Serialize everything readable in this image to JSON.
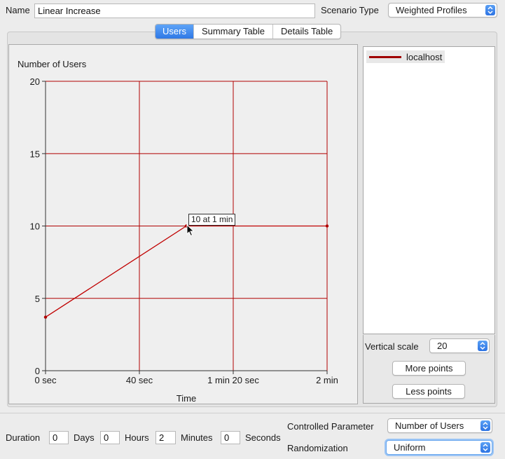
{
  "header": {
    "name_label": "Name",
    "name_value": "Linear Increase",
    "scenario_type_label": "Scenario Type",
    "scenario_type_value": "Weighted Profiles"
  },
  "tabs": [
    {
      "label": "Users",
      "active": true
    },
    {
      "label": "Summary Table",
      "active": false
    },
    {
      "label": "Details Table",
      "active": false
    }
  ],
  "chart_data": {
    "type": "line",
    "title": "",
    "xlabel": "Time",
    "ylabel": "Number of Users",
    "x_ticks": [
      "0 sec",
      "40 sec",
      "1 min 20 sec",
      "2 min"
    ],
    "x_tick_seconds": [
      0,
      40,
      80,
      120
    ],
    "y_ticks": [
      0,
      5,
      10,
      15,
      20
    ],
    "xlim": [
      0,
      120
    ],
    "ylim": [
      0,
      20
    ],
    "grid": true,
    "series": [
      {
        "name": "localhost",
        "color": "#c00000",
        "x": [
          0,
          60,
          120
        ],
        "y": [
          3.7,
          10,
          10
        ]
      }
    ],
    "tooltip": "10 at 1 min"
  },
  "legend": {
    "items": [
      {
        "label": "localhost",
        "color": "#a00000"
      }
    ]
  },
  "side_controls": {
    "vertical_scale_label": "Vertical scale",
    "vertical_scale_value": "20",
    "more_points_label": "More points",
    "less_points_label": "Less points"
  },
  "duration": {
    "label": "Duration",
    "days_value": "0",
    "days_label": "Days",
    "hours_value": "0",
    "hours_label": "Hours",
    "minutes_value": "2",
    "minutes_label": "Minutes",
    "seconds_value": "0",
    "seconds_label": "Seconds"
  },
  "controlled_parameter": {
    "label": "Controlled Parameter",
    "value": "Number of Users"
  },
  "randomization": {
    "label": "Randomization",
    "value": "Uniform"
  }
}
